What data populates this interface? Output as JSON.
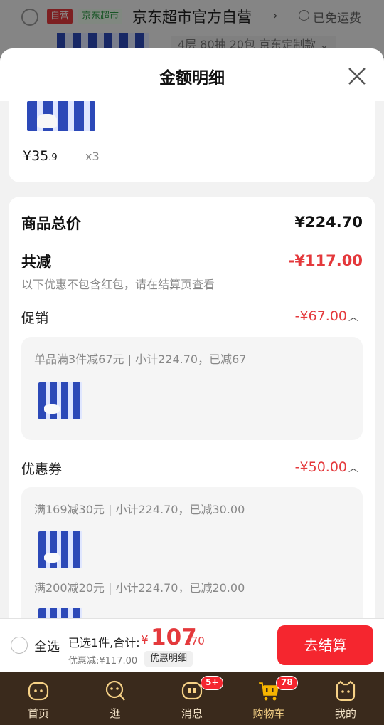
{
  "background_row": {
    "tag_self": "自营",
    "tag_market": "京东超市",
    "store_name": "京东超市官方自营",
    "chevron": "›",
    "free_shipping": "已免运费",
    "spec": "4层 80抽 20包 京东定制款 ⌄"
  },
  "sheet": {
    "title": "金额明细",
    "product": {
      "price_main": "¥35",
      "price_dec": ".9",
      "qty": "x3"
    },
    "summary": {
      "total_label": "商品总价",
      "total_value": "¥224.70",
      "reduce_label": "共减",
      "reduce_value": "-¥117.00",
      "reduce_note": "以下优惠不包含红包，请在结算页查看"
    },
    "promotion": {
      "label": "促销",
      "value": "-¥67.00",
      "detail": "单品满3件减67元 | 小计224.70，已减67"
    },
    "coupon": {
      "label": "优惠券",
      "value": "-¥50.00",
      "details": [
        "满169减30元 | 小计224.70，已减30.00",
        "满200减20元 | 小计224.70，已减20.00"
      ]
    }
  },
  "checkout": {
    "select_all": "全选",
    "selected": "已选1件,合计:",
    "currency": "¥",
    "total_int": "107",
    "total_dec": ".70",
    "discount": "优惠减:¥117.00",
    "discount_button": "优惠明细",
    "pay_button": "去结算"
  },
  "tabs": [
    {
      "label": "首页",
      "icon": "home-face-icon"
    },
    {
      "label": "逛",
      "icon": "explore-face-icon"
    },
    {
      "label": "消息",
      "icon": "message-face-icon",
      "badge": "5+"
    },
    {
      "label": "购物车",
      "icon": "cart-icon",
      "badge": "78"
    },
    {
      "label": "我的",
      "icon": "profile-face-icon"
    }
  ],
  "colors": {
    "accent": "#e4393c",
    "pay_button": "#f5262f",
    "tabbar": "#3a2a1c"
  }
}
